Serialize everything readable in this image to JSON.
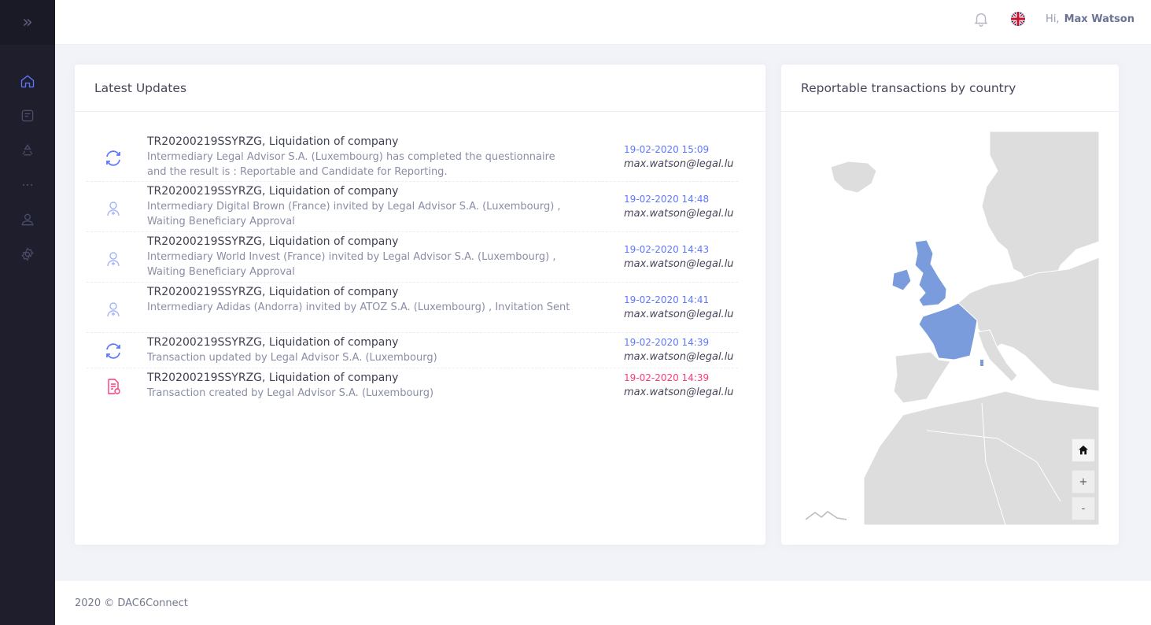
{
  "sidebar": {
    "toggle": "»",
    "items": [
      {
        "icon": "home-icon",
        "active": true
      },
      {
        "icon": "documents-icon",
        "active": false
      },
      {
        "icon": "recycle-icon",
        "active": false
      },
      {
        "icon": "more-dots-icon",
        "active": false
      },
      {
        "icon": "user-icon",
        "active": false
      },
      {
        "icon": "settings-icon",
        "active": false
      }
    ]
  },
  "header": {
    "greeting": "Hi,",
    "user_name": "Max Watson",
    "notification_icon": "bell-icon",
    "language_icon": "uk-flag-icon"
  },
  "updates": {
    "title": "Latest Updates",
    "items": [
      {
        "icon": "sync-icon",
        "title": "TR20200219SSYRZG, Liquidation of company",
        "description": "Intermediary Legal Advisor S.A. (Luxembourg) has completed the questionnaire and the result is : Reportable and Candidate for Reporting.",
        "date": "19-02-2020 15:09",
        "email": "max.watson@legal.lu"
      },
      {
        "icon": "invite-user-icon",
        "title": "TR20200219SSYRZG, Liquidation of company",
        "description": "Intermediary Digital Brown (France) invited by Legal Advisor S.A. (Luxembourg) , Waiting Beneficiary Approval",
        "date": "19-02-2020 14:48",
        "email": "max.watson@legal.lu"
      },
      {
        "icon": "invite-user-icon",
        "title": "TR20200219SSYRZG, Liquidation of company",
        "description": "Intermediary World Invest (France) invited by Legal Advisor S.A. (Luxembourg) , Waiting Beneficiary Approval",
        "date": "19-02-2020 14:43",
        "email": "max.watson@legal.lu"
      },
      {
        "icon": "invite-user-icon",
        "title": "TR20200219SSYRZG, Liquidation of company",
        "description": "Intermediary Adidas (Andorra) invited by ATOZ S.A. (Luxembourg) , Invitation Sent",
        "date": "19-02-2020 14:41",
        "email": "max.watson@legal.lu"
      },
      {
        "icon": "sync-icon",
        "title": "TR20200219SSYRZG, Liquidation of company",
        "description": "Transaction updated by Legal Advisor S.A. (Luxembourg)",
        "date": "19-02-2020 14:39",
        "email": "max.watson@legal.lu"
      },
      {
        "icon": "document-created-icon",
        "title": "TR20200219SSYRZG, Liquidation of company",
        "description": "Transaction created by Legal Advisor S.A. (Luxembourg)",
        "date": "19-02-2020 14:39",
        "email": "max.watson@legal.lu",
        "date_color": "#fd397a"
      }
    ]
  },
  "map_card": {
    "title": "Reportable transactions by country",
    "highlighted_countries": [
      "United Kingdom",
      "France"
    ],
    "highlight_color": "#7b9cdc",
    "land_color": "#dddddd",
    "controls": {
      "home": "home-icon",
      "zoom_in": "+",
      "zoom_out": "-"
    }
  },
  "footer": {
    "copyright": "2020 © DAC6Connect"
  },
  "colors": {
    "accent": "#5d78ff",
    "danger": "#fd397a",
    "sidebar_bg": "#1e1e2d"
  }
}
